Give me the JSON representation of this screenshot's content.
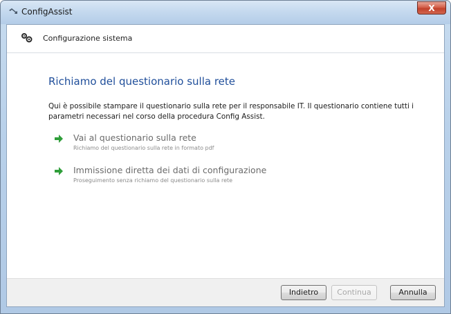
{
  "window": {
    "title": "ConfigAssist",
    "close_label": "X"
  },
  "header": {
    "title": "Configurazione sistema",
    "icon": "gears-icon"
  },
  "main": {
    "title": "Richiamo del questionario sulla rete",
    "intro_line1": "Qui è possibile stampare il questionario sulla rete per il responsabile IT. Il questionario contiene tutti i",
    "intro_line2": "parametri necessari nel corso della procedura Config Assist.",
    "options": [
      {
        "title": "Vai al questionario sulla rete",
        "subtitle": "Richiamo del questionario sulla rete in formato pdf",
        "icon": "green-arrow-icon"
      },
      {
        "title": "Immissione diretta dei dati di configurazione",
        "subtitle": "Proseguimento senza richiamo del questionario sulla rete",
        "icon": "green-arrow-icon"
      }
    ]
  },
  "footer": {
    "back_label": "Indietro",
    "next_label": "Continua",
    "cancel_label": "Annulla"
  },
  "colors": {
    "title_blue": "#1f4e9a",
    "arrow_green": "#2f9e3a",
    "close_red": "#c2412b"
  }
}
